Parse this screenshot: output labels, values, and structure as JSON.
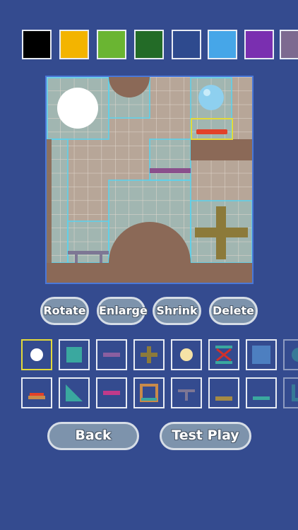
{
  "palette": [
    {
      "name": "black",
      "color": "#000000"
    },
    {
      "name": "yellow",
      "color": "#f3b400"
    },
    {
      "name": "light-green",
      "color": "#6ab532"
    },
    {
      "name": "dark-green",
      "color": "#236b27"
    },
    {
      "name": "navy",
      "color": "#2e4a8e"
    },
    {
      "name": "sky-blue",
      "color": "#46a6e8"
    },
    {
      "name": "purple",
      "color": "#7a2fb0"
    },
    {
      "name": "mauve",
      "color": "#7d6a90"
    }
  ],
  "actions": {
    "rotate": "Rotate",
    "enlarge": "Enlarge",
    "shrink": "Shrink",
    "delete": "Delete"
  },
  "footer": {
    "back": "Back",
    "test_play": "Test Play"
  },
  "pieces_row1": [
    "white-ball",
    "teal-square",
    "purple-bar",
    "cross",
    "cream-ball",
    "x-bar",
    "blue-square",
    "teal-circle"
  ],
  "pieces_row2": [
    "red-platform",
    "teal-triangle",
    "pink-bar",
    "frame",
    "t-shape",
    "brown-bar",
    "teal-bar",
    "corner"
  ],
  "selected_piece": "white-ball",
  "colors": {
    "board_floor": "#b7a698",
    "brown": "#8b6957",
    "grid_highlight": "#58d3f0",
    "selection": "#e3da3a"
  }
}
